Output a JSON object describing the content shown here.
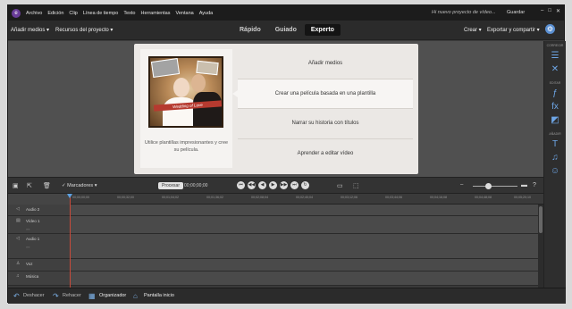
{
  "menubar": {
    "logo_glyph": "e",
    "items": [
      "Archivo",
      "Edición",
      "Clip",
      "Línea de tiempo",
      "Texto",
      "Herramientas",
      "Ventana",
      "Ayuda"
    ],
    "project_name": "Hi nuevo proyecto de vídeo...",
    "save_label": "Guardar",
    "window_controls": [
      "–",
      "□",
      "✕"
    ]
  },
  "toolbar": {
    "add_media": "Añadir medios",
    "project_assets": "Recursos del proyecto",
    "modes": [
      "Rápido",
      "Guiado",
      "Experto"
    ],
    "active_mode": "Experto",
    "create": "Crear",
    "export_share": "Exportar y compartir",
    "settings_icon": "gear-icon"
  },
  "card": {
    "ribbon_text": "Wedding of Love",
    "description": "Utilice plantillas impresionantes y cree su película.",
    "actions": [
      "Añadir medios",
      "Crear una película basada en una plantilla",
      "Narrar su historia con títulos",
      "Aprender a editar vídeo"
    ]
  },
  "right_panel": {
    "sections": [
      "CORREGIR",
      "EDITAR",
      "AÑADIR"
    ],
    "correct_icons": [
      "sliders-icon",
      "tools-icon"
    ],
    "edit_icons": [
      "effects-icon",
      "fx-icon",
      "color-icon"
    ],
    "add_icons": [
      "title-icon",
      "music-icon",
      "graphics-icon"
    ]
  },
  "timeline": {
    "markers_label": "Marcadores",
    "process_label": "Procesar",
    "timecode": "00;00;00;00",
    "transport": [
      "⏮",
      "◀◀",
      "◀",
      "▶",
      "▶▶",
      "⏭",
      "↻"
    ],
    "ruler_ticks": [
      "00;00;00;00",
      "00;00;32;00",
      "00;01;04;02",
      "00;01;36;02",
      "00;02;08;04",
      "00;02;40;04",
      "00;03;12;06",
      "00;03;44;06",
      "00;04;16;08",
      "00;04;48;08",
      "00;05;20;10"
    ],
    "tracks": [
      {
        "name": "Audio 2"
      },
      {
        "name": "Vídeo 1"
      },
      {
        "name": "Audio 1"
      },
      {
        "name": "Voz"
      },
      {
        "name": "Música"
      }
    ]
  },
  "statusbar": {
    "undo": "Deshacer",
    "redo": "Rehacer",
    "organizer": "Organizador",
    "home": "Pantalla inicio"
  }
}
